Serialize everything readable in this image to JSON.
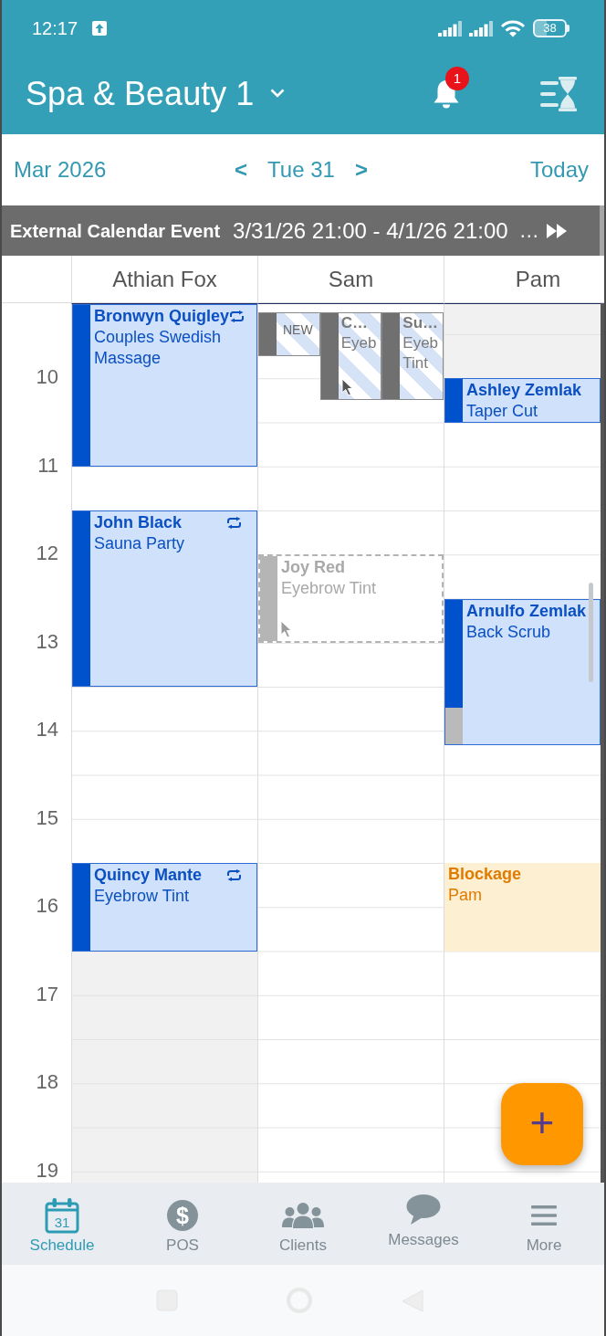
{
  "status_bar": {
    "time": "12:17",
    "battery": "38"
  },
  "app_bar": {
    "title": "Spa & Beauty 1",
    "notification_count": "1"
  },
  "date_nav": {
    "month": "Mar 2026",
    "previous": "<",
    "date": "Tue 31",
    "next": ">",
    "today": "Today"
  },
  "external_event": {
    "title": "External Calendar Event",
    "time_range": "3/31/26 21:00 - 4/1/26 21:00",
    "more": "…"
  },
  "calendar": {
    "hours": [
      "10",
      "11",
      "12",
      "13",
      "14",
      "15",
      "16",
      "17",
      "18",
      "19"
    ],
    "columns": [
      {
        "name": "Athian Fox",
        "events": [
          {
            "kind": "appointment",
            "client": "Bronwyn Quigley",
            "service": "Couples Swedish Massage",
            "shared": false,
            "recurring": true,
            "pointer": false,
            "buffer": false
          },
          {
            "kind": "appointment",
            "client": "John Black",
            "service": "Sauna Party",
            "shared": false,
            "recurring": true,
            "pointer": false,
            "buffer": false
          },
          {
            "kind": "appointment",
            "client": "Quincy Mante",
            "service": "Eyebrow Tint",
            "shared": false,
            "recurring": true,
            "pointer": false,
            "buffer": false
          }
        ]
      },
      {
        "name": "Sam",
        "events": [
          {
            "kind": "new",
            "label": "NEW",
            "shared": true,
            "recurring": false,
            "pointer": false,
            "buffer": false
          },
          {
            "kind": "pending",
            "client": "C…",
            "service": "Eyeb",
            "shared": true,
            "recurring": false,
            "pointer": true,
            "buffer": false
          },
          {
            "kind": "pending",
            "client": "Su…",
            "service": "Eyeb Tint",
            "shared": true,
            "recurring": false,
            "pointer": false,
            "buffer": false
          },
          {
            "kind": "ghost",
            "client": "Joy Red",
            "service": "Eyebrow Tint",
            "shared": false,
            "recurring": false,
            "pointer": true,
            "buffer": false
          }
        ]
      },
      {
        "name": "Pam",
        "events": [
          {
            "kind": "appointment",
            "client": "Ashley Zemlak",
            "service": "Taper Cut",
            "shared": false,
            "recurring": false,
            "pointer": false,
            "buffer": false
          },
          {
            "kind": "appointment",
            "client": "Arnulfo Zemlak",
            "service": "Back Scrub",
            "shared": false,
            "recurring": false,
            "pointer": false,
            "buffer": true
          },
          {
            "kind": "blockage",
            "title": "Blockage",
            "staff": "Pam",
            "shared": false,
            "recurring": false,
            "pointer": false,
            "buffer": false
          }
        ]
      }
    ]
  },
  "add_button": {
    "label": "+"
  },
  "bottom_nav": [
    {
      "kind": "schedule",
      "label": "Schedule",
      "icon_text": "31",
      "selected": true
    },
    {
      "kind": "pos",
      "label": "POS",
      "icon_text": "$",
      "selected": false
    },
    {
      "kind": "clients",
      "label": "Clients",
      "selected": false
    },
    {
      "kind": "messages",
      "label": "Messages",
      "selected": false
    },
    {
      "kind": "more",
      "label": "More",
      "selected": false
    }
  ]
}
